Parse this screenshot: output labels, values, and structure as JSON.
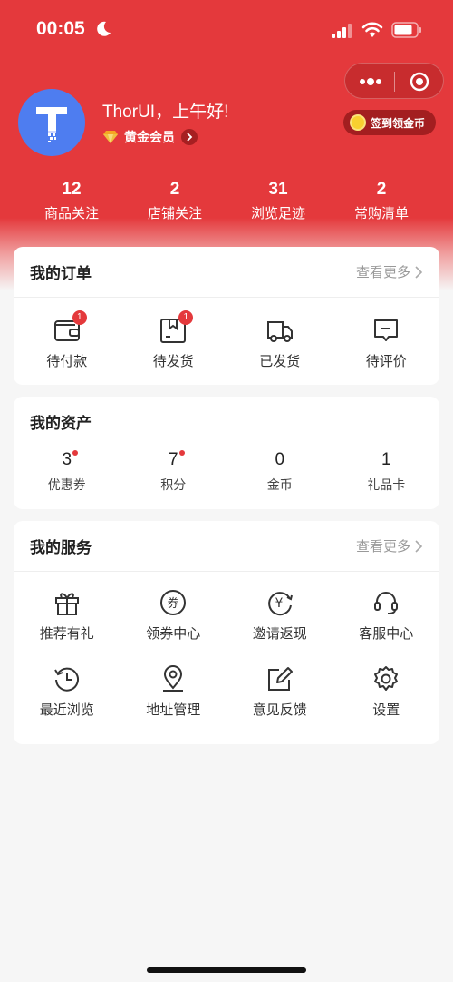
{
  "status_bar": {
    "time": "00:05"
  },
  "profile": {
    "username": "ThorUI，上午好!",
    "member_label": "黄金会员",
    "checkin_label": "签到领金币"
  },
  "stats": [
    {
      "value": "12",
      "label": "商品关注"
    },
    {
      "value": "2",
      "label": "店铺关注"
    },
    {
      "value": "31",
      "label": "浏览足迹"
    },
    {
      "value": "2",
      "label": "常购清单"
    }
  ],
  "orders": {
    "title": "我的订单",
    "more": "查看更多",
    "items": [
      {
        "label": "待付款",
        "icon": "wallet-icon",
        "badge": "1"
      },
      {
        "label": "待发货",
        "icon": "package-icon",
        "badge": "1"
      },
      {
        "label": "已发货",
        "icon": "truck-icon"
      },
      {
        "label": "待评价",
        "icon": "comment-icon"
      }
    ]
  },
  "assets": {
    "title": "我的资产",
    "items": [
      {
        "value": "3",
        "label": "优惠券",
        "dot": true
      },
      {
        "value": "7",
        "label": "积分",
        "dot": true
      },
      {
        "value": "0",
        "label": "金币"
      },
      {
        "value": "1",
        "label": "礼品卡"
      }
    ]
  },
  "services": {
    "title": "我的服务",
    "more": "查看更多",
    "items": [
      {
        "label": "推荐有礼",
        "icon": "gift-icon"
      },
      {
        "label": "领券中心",
        "icon": "coupon-icon",
        "icon_text": "券"
      },
      {
        "label": "邀请返现",
        "icon": "cashback-icon",
        "icon_text": "¥"
      },
      {
        "label": "客服中心",
        "icon": "headset-icon"
      },
      {
        "label": "最近浏览",
        "icon": "history-icon"
      },
      {
        "label": "地址管理",
        "icon": "location-icon"
      },
      {
        "label": "意见反馈",
        "icon": "feedback-icon"
      },
      {
        "label": "设置",
        "icon": "settings-icon"
      }
    ]
  },
  "colors": {
    "brand": "#e4393c",
    "avatar": "#4e7df0"
  }
}
